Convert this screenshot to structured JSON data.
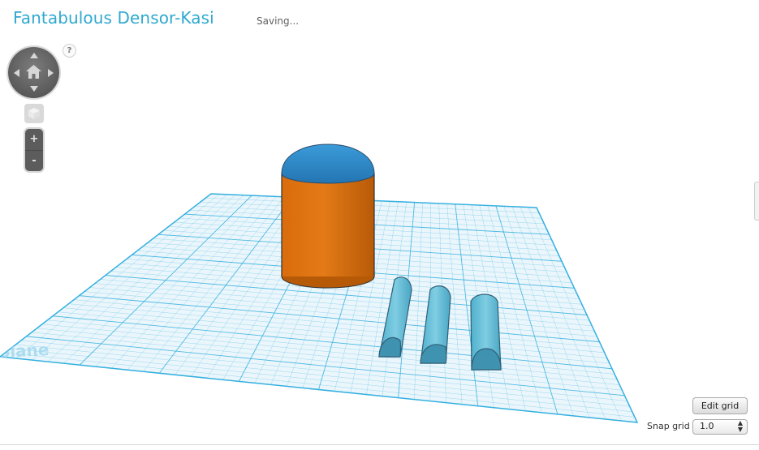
{
  "project": {
    "title": "Fantabulous Densor-Kasi",
    "status": "Saving..."
  },
  "controls": {
    "help_label": "?",
    "zoom_in_label": "+",
    "zoom_out_label": "-",
    "nav_icons": [
      "orbit-up-icon",
      "orbit-down-icon",
      "orbit-left-icon",
      "orbit-right-icon",
      "home-icon"
    ],
    "view_cube_icon": "cube-icon"
  },
  "workplane": {
    "label": "Workplane",
    "grid_color": "#35b0e0",
    "grid_bg": "#e8f5fb"
  },
  "shapes": {
    "cylinder_body_color": "#e37311",
    "cylinder_cap_color": "#2f8fce",
    "half_cylinder_color": "#5fbcd6"
  },
  "grid_panel": {
    "edit_grid_label": "Edit grid",
    "snap_grid_label": "Snap grid",
    "snap_grid_value": "1.0"
  }
}
